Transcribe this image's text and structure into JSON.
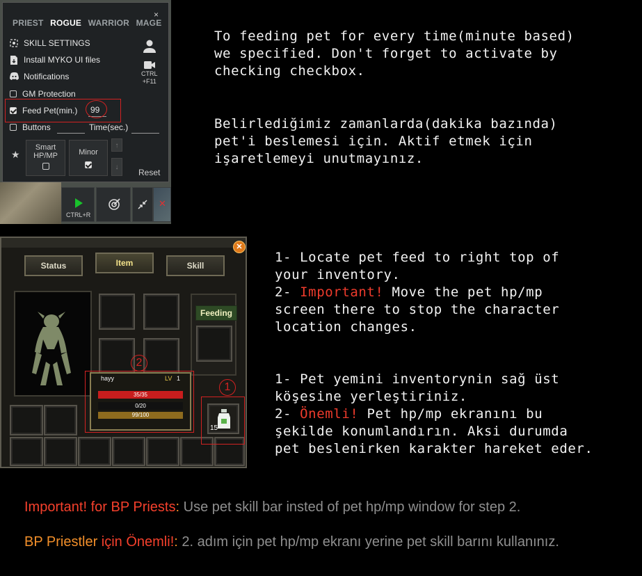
{
  "panel": {
    "tabs": [
      "PRIEST",
      "ROGUE",
      "WARRIOR",
      "MAGE"
    ],
    "active_tab": "ROGUE",
    "close": "×",
    "items": {
      "skill_settings": "SKILL SETTINGS",
      "install_myko": "Install MYKO UI files",
      "notifications": "Notifications",
      "gm_protection": "GM Protection",
      "feed_pet": "Feed Pet(min.)",
      "feed_pet_value": "99",
      "buttons": "Buttons",
      "time": "Time(sec.)"
    },
    "ctrl_f11": [
      "CTRL",
      "+F11"
    ],
    "smart_hpmp": [
      "Smart",
      "HP/MP"
    ],
    "minor": "Minor",
    "reset": "Reset",
    "play_shortcut": "CTRL+R",
    "icons": [
      "user-icon",
      "camera-icon",
      "play-icon",
      "target-icon",
      "collapse-icon",
      "star-icon"
    ]
  },
  "inventory": {
    "tabs": [
      "Status",
      "Item",
      "Skill"
    ],
    "active_tab": "Item",
    "feeding_label": "Feeding",
    "pet_name": "hayy",
    "pet_lv_label": "LV",
    "pet_lv": "1",
    "hp": "35/35",
    "mp": "0/20",
    "exp": "99/100",
    "item_count": "15",
    "marker_1": "1",
    "marker_2": "2"
  },
  "text": {
    "en_feed": "To feeding pet for every time(minute based)\nwe specified. Don't forget to activate by\nchecking checkbox.",
    "tr_feed": "Belirlediğimiz zamanlarda(dakika bazında)\npet'i beslemesi için. Aktif etmek için\nişaretlemeyi unutmayınız.",
    "en_step1": "1- Locate pet feed to right top of\nyour inventory.",
    "en_step2_prefix": "2- ",
    "en_step2_important": "Important!",
    "en_step2_rest": " Move the pet hp/mp\nscreen there to stop the character\nlocation changes.",
    "tr_step1": "1- Pet yemini inventorynin sağ üst\nköşesine yerleştiriniz.",
    "tr_step2_prefix": "2- ",
    "tr_step2_important": "Önemli!",
    "tr_step2_rest": " Pet hp/mp ekranını bu\nşekilde konumlandırın. Aksi durumda\npet beslenirken karakter hareket eder."
  },
  "notes": {
    "en_important": "Important! for BP Priests",
    "en_colon": ":",
    "en_rest": " Use pet skill bar insted of pet hp/mp window for step 2.",
    "tr_bp": "BP Priestler ",
    "tr_important": "için Önemli!",
    "tr_colon": ":",
    "tr_rest": " 2. adım için pet hp/mp ekranı yerine pet skill barını kullanınız."
  },
  "colors": {
    "important_red": "#f5402c",
    "bp_orange": "#f28f2a",
    "note_gray": "#8f8f8f",
    "marker_red": "#d32222"
  }
}
